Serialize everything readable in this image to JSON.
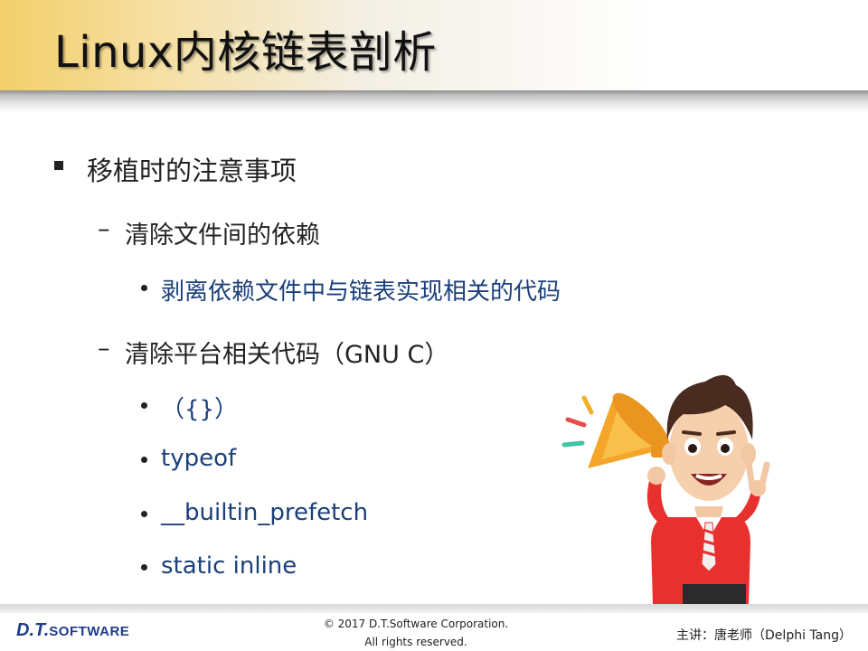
{
  "title": "Linux内核链表剖析",
  "outline": {
    "item1": "移植时的注意事项",
    "item1_1": "清除文件间的依赖",
    "item1_1_1": "剥离依赖文件中与链表实现相关的代码",
    "item1_2": "清除平台相关代码（GNU C）",
    "item1_2_items": [
      "（{}）",
      "typeof",
      "__builtin_prefetch",
      "static inline"
    ]
  },
  "footer": {
    "logo_dt": "D.T.",
    "logo_software": "SOFTWARE",
    "copyright_line1": "© 2017 D.T.Software Corporation.",
    "copyright_line2": "All rights reserved.",
    "presenter": "主讲：唐老师（Delphi Tang）"
  },
  "colors": {
    "header_gold": "#f2cf6a",
    "sub_item_blue": "#1a3f7a",
    "logo_blue": "#1e3c8c",
    "logo_red": "#d22222"
  },
  "illustration": "cartoon-man-with-megaphone"
}
